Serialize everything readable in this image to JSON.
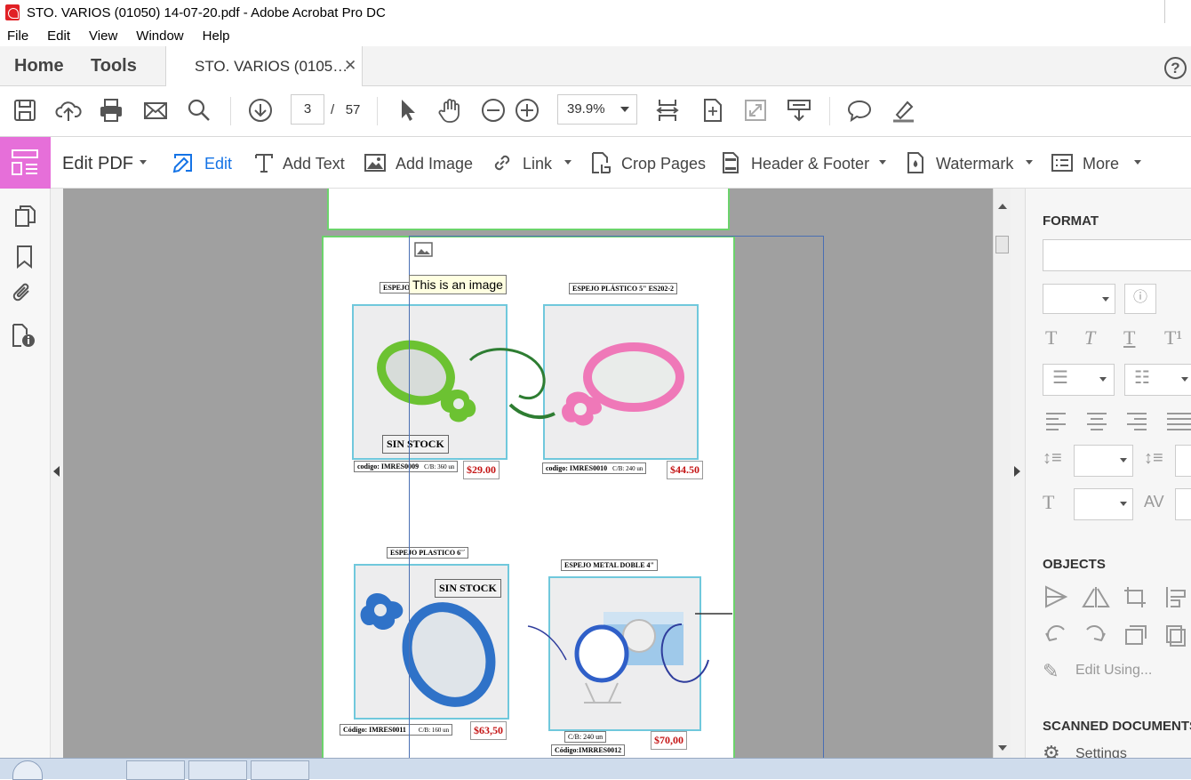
{
  "window": {
    "title": "STO. VARIOS (01050) 14-07-20.pdf - Adobe Acrobat Pro DC"
  },
  "menu": [
    "File",
    "Edit",
    "View",
    "Window",
    "Help"
  ],
  "tabs": {
    "home": "Home",
    "tools": "Tools",
    "document": "STO. VARIOS (0105…",
    "help": "?"
  },
  "toolbar": {
    "current_page": "3",
    "page_sep": "/",
    "total_pages": "57",
    "zoom": "39.9%"
  },
  "edit_toolbar": {
    "title": "Edit PDF",
    "edit": "Edit",
    "add_text": "Add Text",
    "add_image": "Add Image",
    "link": "Link",
    "crop_pages": "Crop Pages",
    "header_footer": "Header & Footer",
    "watermark": "Watermark",
    "more": "More"
  },
  "tooltip": "This is an image",
  "right_panel": {
    "format_heading": "FORMAT",
    "objects_heading": "OBJECTS",
    "edit_using": "Edit Using...",
    "scanned_heading": "SCANNED DOCUMENTS",
    "settings": "Settings"
  },
  "products": [
    {
      "title": "ESPEJO",
      "stock": "SIN STOCK",
      "code": "codigo: IMRES0009",
      "cb": "C/B: 360 un",
      "price": "$29.00"
    },
    {
      "title": "ESPEJO PLÁSTICO 5\" ES202-2",
      "code": "codigo: IMRES0010",
      "cb": "C/B: 240 un",
      "price": "$44.50"
    },
    {
      "title": "ESPEJO PLASTICO 6¨´",
      "stock": "SIN STOCK",
      "code": "Código: IMRES0011",
      "cb": "C/B: 160 un",
      "price": "$63,50"
    },
    {
      "title": "ESPEJO METAL DOBLE 4\"",
      "cb": "C/B: 240 un",
      "code": "Código:IMRRES0012",
      "price": "$70,00"
    }
  ],
  "colors": {
    "edit_pdf_accent": "#e66fd9",
    "link_blue": "#1473e6",
    "page_border": "#6cd36c",
    "card_border": "#70c8dc",
    "price_red": "#c41414"
  }
}
